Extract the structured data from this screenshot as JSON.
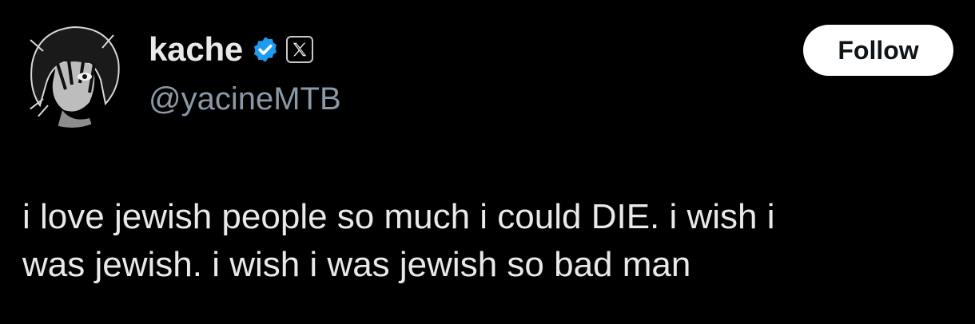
{
  "author": {
    "display_name": "kache",
    "handle": "@yacineMTB",
    "verified": true,
    "badges": [
      "verified-badge-icon",
      "x-logo-icon"
    ],
    "avatar_icon": "anime-avatar"
  },
  "actions": {
    "follow_label": "Follow"
  },
  "tweet": {
    "text_line_1": "i love jewish people so much i could DIE. i wish i",
    "text_line_2": "was jewish. i wish i was jewish so bad man"
  },
  "colors": {
    "background": "#000000",
    "text_primary": "#e7e9ea",
    "text_secondary": "#8b98a5",
    "verified_blue": "#1d9bf0",
    "follow_bg": "#ffffff"
  }
}
